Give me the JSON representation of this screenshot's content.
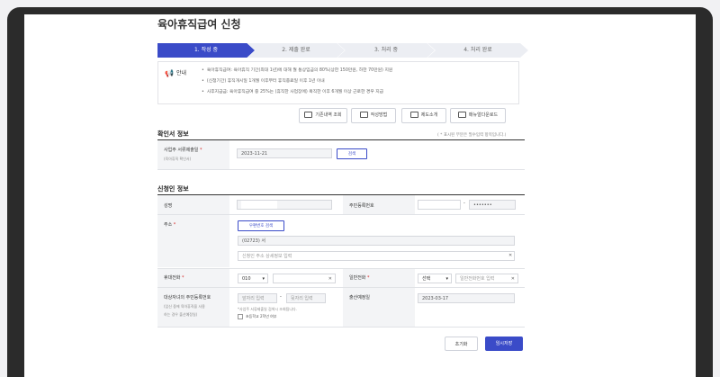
{
  "page": {
    "title": "육아휴직급여 신청"
  },
  "steps": [
    {
      "label": "1. 작성 중",
      "active": true
    },
    {
      "label": "2. 제출 완료",
      "active": false
    },
    {
      "label": "3. 처리 중",
      "active": false
    },
    {
      "label": "4. 처리 완료",
      "active": false
    }
  ],
  "guide": {
    "label": "안내",
    "items": [
      "육아휴직급여: 육아휴직 기간(최대 1년)에 대해 월 통상임금의 80%(상한 150만원, 하한 70만원) 지원",
      "(신청기간) 휴직개시일 1개월 이후부터 휴직종료일 이후 1년 이내",
      "사후지급금: 육아휴직급여 중 25%는 (휴직한 사업장에) 복직한 이후 6개월 이상 근로한 경우 지급"
    ]
  },
  "toolbar": {
    "history": "기존내역 조회",
    "howto": "작성방법",
    "intro": "제도소개",
    "manual": "매뉴얼다운로드"
  },
  "confirm_section": {
    "title": "확인서 정보",
    "required_note": "( * 표시된 부분은 필수입력 항목입니다.)",
    "date_label": "사업주 서류제출일",
    "date_sublabel": "(육아휴직 확인서)",
    "date_value": "2023-11-21",
    "search_button": "검색"
  },
  "applicant_section": {
    "title": "신청인 정보",
    "name_label": "성명",
    "rrn_label": "주민등록번호",
    "rrn_masked": "•••••••",
    "rrn_dash": "-",
    "address_label": "주소",
    "zip_button": "우편번호 검색",
    "address_value": "(02723) 서",
    "address_detail_placeholder": "신청인 주소 상세정보 입력",
    "mobile_label": "휴대전화",
    "mobile_prefix": "010",
    "phone_label": "일반전화",
    "phone_select": "선택",
    "phone_placeholder": "일반전화번호 입력",
    "child_label": "대상자녀의 주민등록번호",
    "child_sublabel1": "(임신 중에 육아휴직을 사용",
    "child_sublabel2": "하는 경우 출산예정일)",
    "child_front_placeholder": "앞자리 입력",
    "child_back_placeholder": "뒷자리 입력",
    "child_dash": "-",
    "child_note": "*사업주 서류제출일 검색시 조회됩니다.",
    "school_checkbox": "초등학교 2학년 여부",
    "birth_label": "출산예정일",
    "birth_value": "2023-03-17"
  },
  "footer": {
    "reset": "초기화",
    "save": "임시저장"
  },
  "colors": {
    "accent": "#3a4bc8",
    "required": "#d62828",
    "guide_icon": "#3bb56b"
  }
}
